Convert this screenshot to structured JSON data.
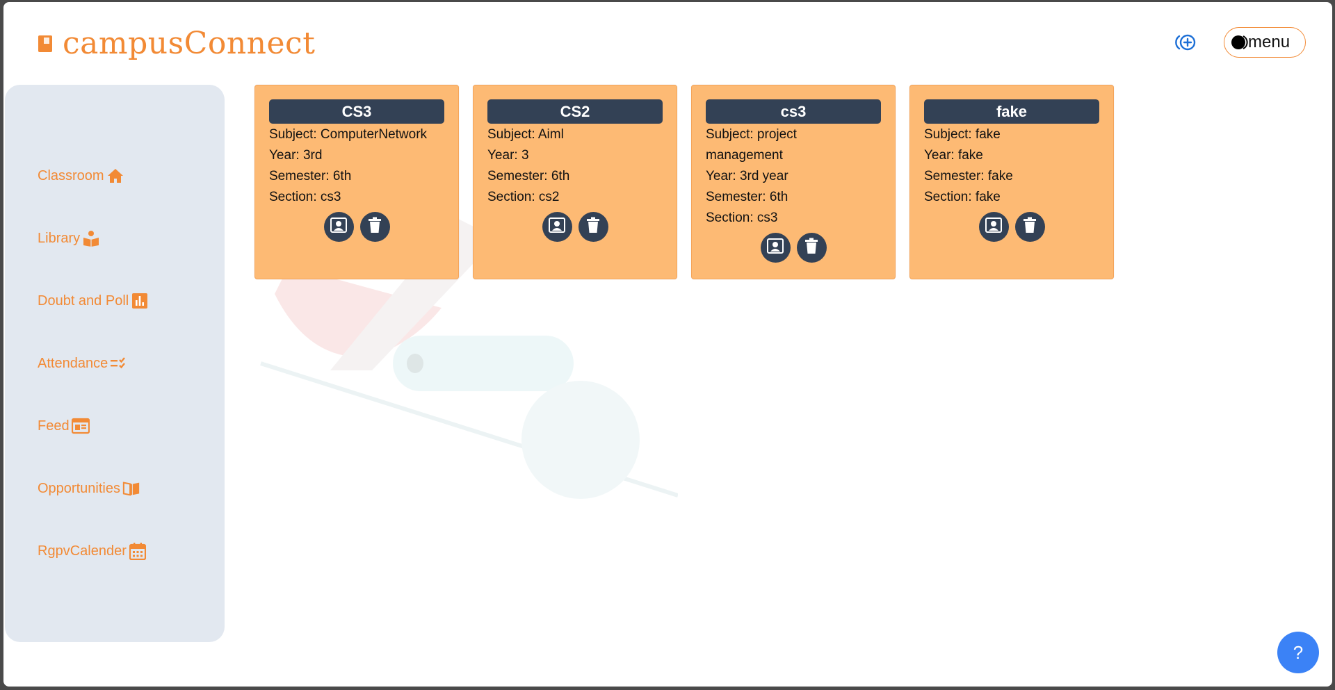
{
  "app": {
    "brand_name": "campusConnect",
    "brand_icon": "book-icon",
    "brand_color": "#f28a35"
  },
  "header": {
    "add_class_icon": "add-circle-icon",
    "menu_label": "menu",
    "menu_icon": "half-moon-toggle-icon"
  },
  "sidebar": {
    "items": [
      {
        "label": "Classroom",
        "icon": "home-icon"
      },
      {
        "label": "Library",
        "icon": "reader-icon"
      },
      {
        "label": "Doubt and Poll",
        "icon": "poll-chart-icon"
      },
      {
        "label": "Attendance",
        "icon": "checklist-icon"
      },
      {
        "label": "Feed",
        "icon": "feed-icon"
      },
      {
        "label": "Opportunities",
        "icon": "open-book-icon"
      },
      {
        "label": "RgpvCalender",
        "icon": "calendar-icon"
      }
    ]
  },
  "classes": [
    {
      "title": "CS3",
      "lines": [
        "Subject: ComputerNetwork",
        "Year: 3rd",
        "Semester: 6th",
        "Section: cs3"
      ]
    },
    {
      "title": "CS2",
      "lines": [
        "Subject: Aiml",
        "Year: 3",
        "Semester: 6th",
        "Section: cs2"
      ]
    },
    {
      "title": "cs3",
      "lines": [
        "Subject: project",
        "management",
        "Year: 3rd year",
        "Semester: 6th",
        "Section: cs3"
      ]
    },
    {
      "title": "fake",
      "lines": [
        "Subject: fake",
        "Year: fake",
        "Semester: fake",
        "Section: fake"
      ]
    }
  ],
  "card_actions": {
    "open_icon": "contact-card-icon",
    "delete_icon": "trash-icon"
  },
  "help": {
    "label": "?"
  },
  "colors": {
    "accent": "#f28a35",
    "card_bg": "#fdba74",
    "card_title_bg": "#334155",
    "sidebar_bg": "#e2e8f0",
    "help_bg": "#3b82f6",
    "add_icon": "#1d6fd6"
  }
}
